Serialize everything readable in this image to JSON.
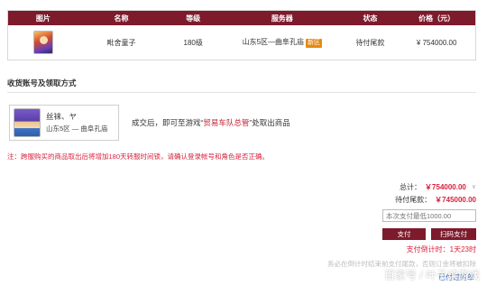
{
  "table": {
    "headers": [
      "图片",
      "名称",
      "等级",
      "服务器",
      "状态",
      "价格（元）"
    ],
    "row": {
      "name": "毗舍童子",
      "level": "180级",
      "server": "山东5区—曲阜孔庙",
      "server_tag": "新区",
      "status": "待付尾款",
      "price": "¥ 754000.00"
    }
  },
  "section": {
    "title": "收货账号及领取方式"
  },
  "character": {
    "name": "丝袜、ヤ",
    "server": "山东5区 — 曲阜孔庙"
  },
  "pickup": {
    "prefix": "成交后，即可至游戏“",
    "highlight": "贸易车队总管",
    "suffix": "”处取出商品"
  },
  "notice": "注：跨服购买的商品取出后将增加180天转服时间锁，请确认登录帐号和角色是否正确。",
  "summary": {
    "total_label": "总计：",
    "total_value": "￥754000.00",
    "balance_label": "待付尾款：",
    "balance_value": "￥745000.00"
  },
  "payment": {
    "placeholder": "本次支付最低1000.00",
    "pay_label": "支付",
    "scan_label": "扫码支付",
    "countdown": "支付倒计时：1天23时",
    "countdown_note": "务必在倒计时结束前支付尾款，否则订金将被扣除"
  },
  "watermark": "百家号 / 叶子读游戏",
  "more_link": "已付过的单"
}
